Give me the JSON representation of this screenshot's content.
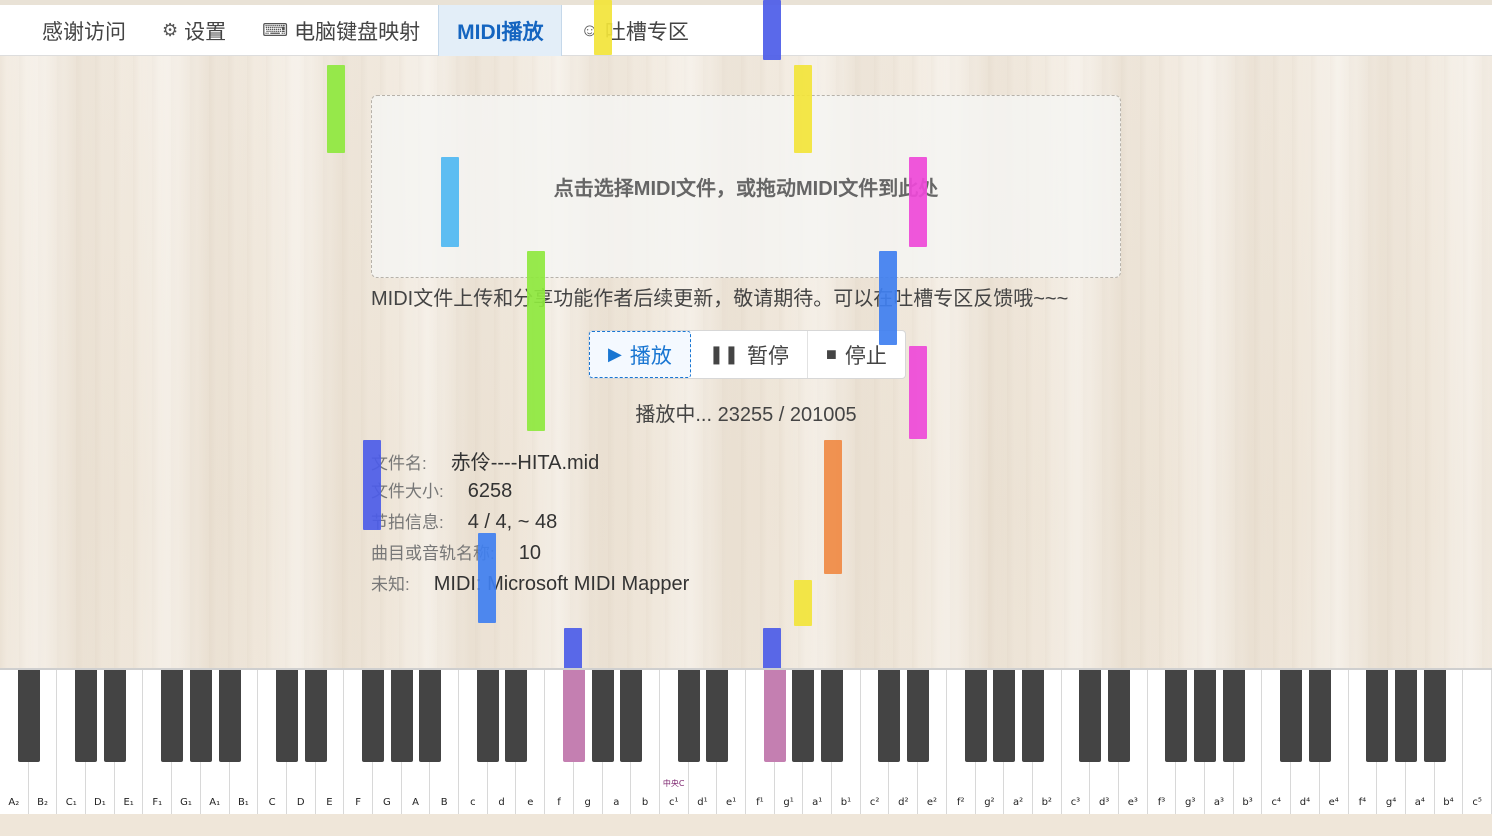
{
  "tabs": [
    {
      "label": "感谢访问",
      "icon": ""
    },
    {
      "label": "设置",
      "icon": "⚙"
    },
    {
      "label": "电脑键盘映射",
      "icon": "⌨"
    },
    {
      "label": "MIDI播放",
      "icon": ""
    },
    {
      "label": "吐槽专区",
      "icon": "☺"
    }
  ],
  "dropzone": {
    "text": "点击选择MIDI文件，或拖动MIDI文件到此处"
  },
  "notice": "MIDI文件上传和分享功能作者后续更新，敬请期待。可以在吐槽专区反馈哦~~~",
  "controls": {
    "play": "播放",
    "pause": "暂停",
    "stop": "停止"
  },
  "progress": "播放中... 23255 / 201005",
  "info": [
    {
      "label": "文件名:",
      "value": "赤伶----HITA.mid"
    },
    {
      "label": "文件大小:",
      "value": "6258"
    },
    {
      "label": "节拍信息:",
      "value": "4 / 4, ~ 48"
    },
    {
      "label": "曲目或音轨名称:",
      "value": "10"
    },
    {
      "label": "未知:",
      "value": "MIDI: Microsoft MIDI Mapper"
    }
  ],
  "keyboard": {
    "white_keys": [
      "A₂",
      "B₂",
      "C₁",
      "D₁",
      "E₁",
      "F₁",
      "G₁",
      "A₁",
      "B₁",
      "C",
      "D",
      "E",
      "F",
      "G",
      "A",
      "B",
      "c",
      "d",
      "e",
      "f",
      "g",
      "a",
      "b",
      "c¹",
      "d¹",
      "e¹",
      "f¹",
      "g¹",
      "a¹",
      "b¹",
      "c²",
      "d²",
      "e²",
      "f²",
      "g²",
      "a²",
      "b²",
      "c³",
      "d³",
      "e³",
      "f³",
      "g³",
      "a³",
      "b³",
      "c⁴",
      "d⁴",
      "e⁴",
      "f⁴",
      "g⁴",
      "a⁴",
      "b⁴",
      "c⁵"
    ],
    "middle_c_label": "中央C"
  },
  "colors": {
    "accent": "#1565c0",
    "pressed_key": "#c47fb1",
    "note_green": "#8ee83e",
    "note_yellow": "#f2e43a",
    "note_blue": "#3f7ff0",
    "note_indigo": "#4c5ce8",
    "note_cyan": "#4fb8f2",
    "note_magenta": "#ee49d8",
    "note_orange": "#f08a44"
  }
}
